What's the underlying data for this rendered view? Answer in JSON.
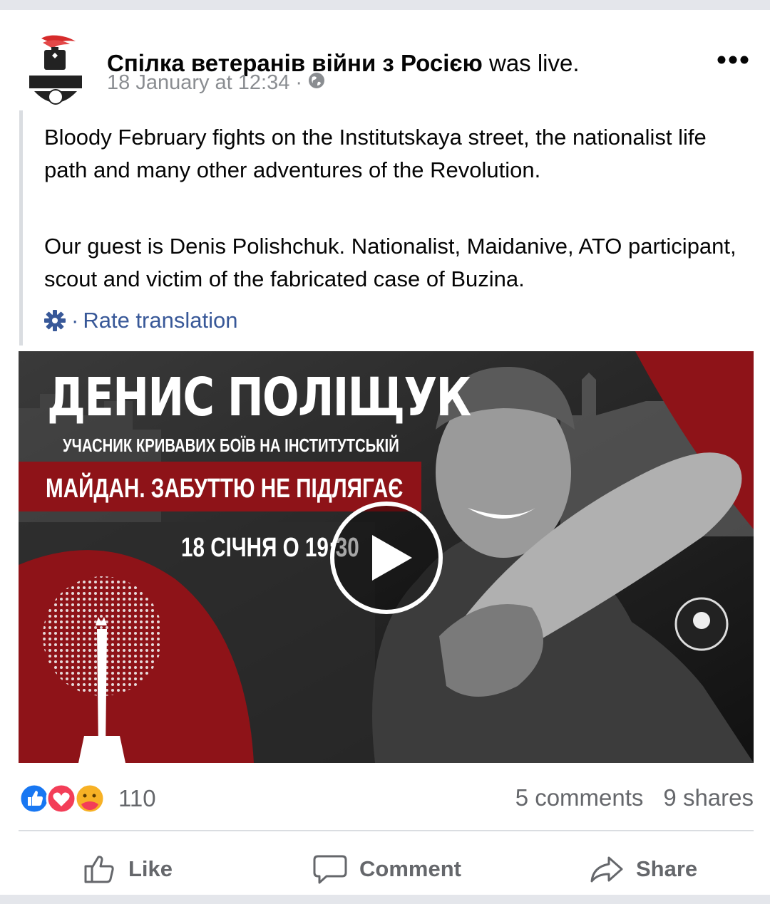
{
  "post": {
    "author_name": "Спілка ветеранів війни з Росією",
    "author_suffix": " was live.",
    "timestamp": "18 January at 12:34 ·",
    "privacy_icon": "globe-icon",
    "paragraph1": "Bloody February fights on the Institutskaya street, the nationalist life path and many other adventures of the Revolution.",
    "paragraph2": "Our guest is Denis Polishchuk. Nationalist, Maidanive, ATO participant, scout and victim of the fabricated case of Buzina.",
    "rate_translation": "Rate translation",
    "rate_separator": "·"
  },
  "video": {
    "title": "ДЕНИС ПОЛІЩУК",
    "subtitle": "УЧАСНИК КРИВАВИХ БОЇВ НА ІНСТИТУТСЬКІЙ",
    "banner": "МАЙДАН. ЗАБУТТЮ НЕ ПІДЛЯГАЄ",
    "date": "18 СІЧНЯ О 19:30",
    "accent_color": "#8e1318"
  },
  "stats": {
    "reaction_count": "110",
    "comments": "5 comments",
    "shares": "9 shares"
  },
  "actions": {
    "like": "Like",
    "comment": "Comment",
    "share": "Share"
  },
  "colors": {
    "link": "#385898",
    "secondary_text": "#65676b",
    "like_blue": "#1877f2",
    "love_red": "#f33e58"
  }
}
